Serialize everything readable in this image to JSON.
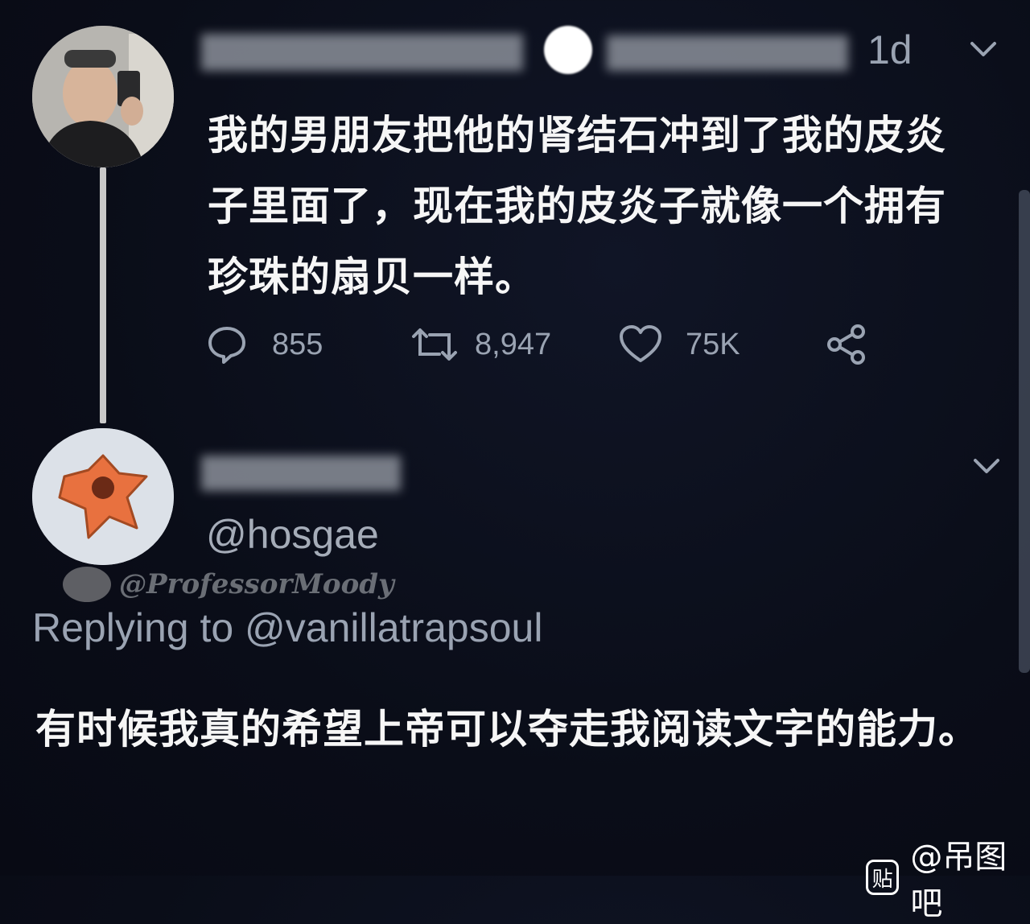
{
  "colors": {
    "background": "#0a0d18",
    "text_primary": "#f6f6f6",
    "text_secondary": "#9aa3b2",
    "thread_line": "#c9c9c9"
  },
  "tweet": {
    "timestamp": "1d",
    "menu_icon": "chevron-down-icon",
    "avatar_icon": "avatar",
    "text": "我的男朋友把他的肾结石冲到了我的皮炎子里面了，现在我的皮炎子就像一个拥有珍珠的扇贝一样。",
    "actions": {
      "reply": {
        "icon": "reply-icon",
        "count": "855"
      },
      "retweet": {
        "icon": "retweet-icon",
        "count": "8,947"
      },
      "like": {
        "icon": "heart-icon",
        "count": "75K"
      },
      "share": {
        "icon": "share-icon"
      }
    }
  },
  "reply_tweet": {
    "handle": "@hosgae",
    "menu_icon": "chevron-down-icon",
    "replying_to": "Replying to @vanillatrapsoul",
    "text": "有时候我真的希望上帝可以夺走我阅读文字的能力。"
  },
  "overlay_watermark": {
    "text": "@ProfessorMoody"
  },
  "site_watermark": {
    "badge": "贴",
    "text": "@吊图吧"
  }
}
